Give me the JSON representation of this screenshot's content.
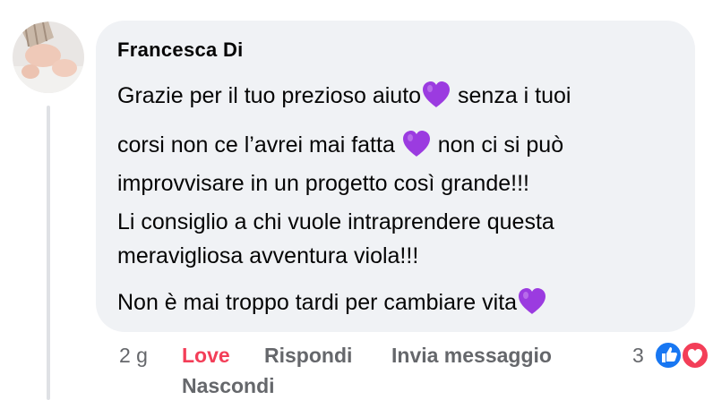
{
  "comment": {
    "author": "Francesca Di",
    "lines": [
      {
        "segments": [
          "Grazie per il tuo prezioso aiuto",
          "heart",
          " senza i tuoi"
        ]
      },
      {
        "segments": [
          "corsi non ce l’avrei mai fatta ",
          "heart",
          " non ci si può"
        ]
      },
      {
        "segments": [
          "improvvisare in un progetto così grande!!!"
        ]
      },
      {
        "segments": [
          "Li consiglio a chi vuole intraprendere questa"
        ]
      },
      {
        "segments": [
          "meravigliosa avventura viola!!!"
        ]
      },
      {
        "segments": [
          "Non è mai troppo tardi per cambiare vita",
          "heart"
        ]
      }
    ]
  },
  "actions": {
    "time": "2 g",
    "love": "Love",
    "reply": "Rispondi",
    "message": "Invia messaggio",
    "hide": "Nascondi"
  },
  "reactions": {
    "count": "3",
    "icons": [
      "like-icon",
      "love-icon"
    ]
  },
  "colors": {
    "bubble": "#f0f2f5",
    "love": "#f33e58",
    "secondary_text": "#65676b",
    "heart_emoji": "#9b3be0",
    "like_blue": "#1877f2"
  }
}
